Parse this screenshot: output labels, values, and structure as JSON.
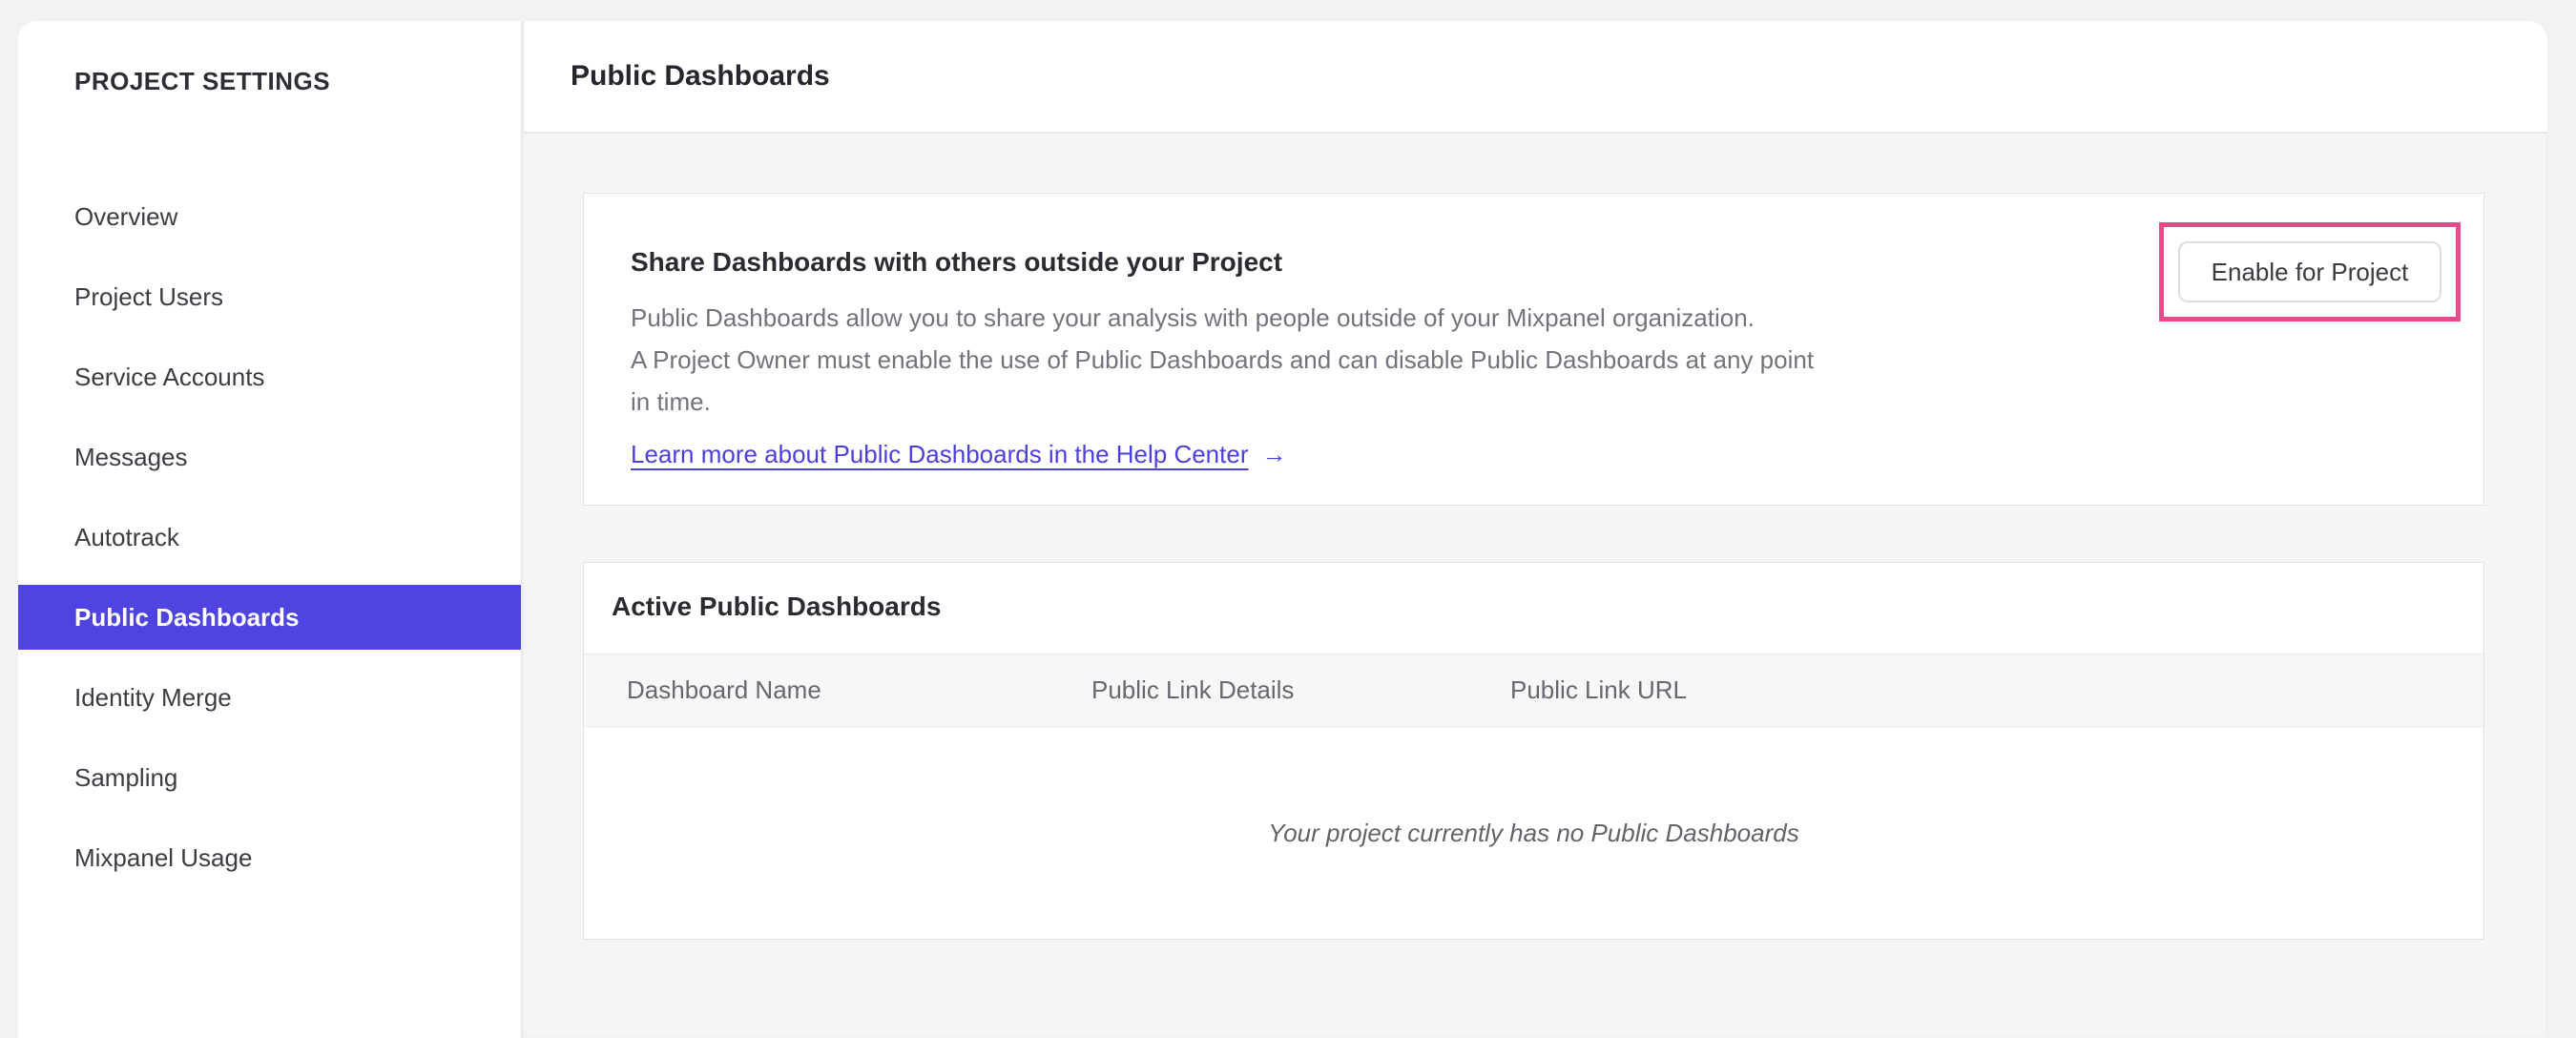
{
  "sidebar": {
    "title": "PROJECT SETTINGS",
    "items": [
      {
        "label": "Overview",
        "selected": false
      },
      {
        "label": "Project Users",
        "selected": false
      },
      {
        "label": "Service Accounts",
        "selected": false
      },
      {
        "label": "Messages",
        "selected": false
      },
      {
        "label": "Autotrack",
        "selected": false
      },
      {
        "label": "Public Dashboards",
        "selected": true
      },
      {
        "label": "Identity Merge",
        "selected": false
      },
      {
        "label": "Sampling",
        "selected": false
      },
      {
        "label": "Mixpanel Usage",
        "selected": false
      }
    ]
  },
  "header": {
    "title": "Public Dashboards"
  },
  "share_card": {
    "heading": "Share Dashboards with others outside your Project",
    "body_lines": [
      "Public Dashboards allow you to share your analysis with people outside of your Mixpanel organization.",
      "A Project Owner must enable the use of Public Dashboards and can disable Public Dashboards at any point",
      "in time."
    ],
    "link_label": "Learn more about Public Dashboards in the Help Center",
    "link_arrow": "→",
    "button_label": "Enable for Project"
  },
  "active_card": {
    "heading": "Active Public Dashboards",
    "columns": [
      "Dashboard Name",
      "Public Link Details",
      "Public Link URL"
    ],
    "empty_message": "Your project currently has no Public Dashboards"
  },
  "colors": {
    "accent_indigo": "#4f44e0",
    "link_indigo": "#4b40da",
    "annotation_pink": "#e84a8c"
  }
}
